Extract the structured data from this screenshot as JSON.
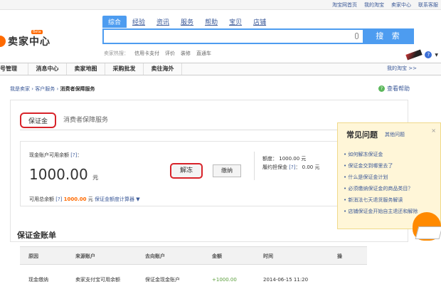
{
  "topbar": {
    "links": [
      "淘宝网首页",
      "我的淘宝",
      "卖家中心",
      "联系客服"
    ]
  },
  "logo": {
    "text": "卖家中心",
    "badge": "Beta"
  },
  "search": {
    "tabs": [
      "综合",
      "经验",
      "资讯",
      "服务",
      "帮助",
      "宝贝",
      "店铺"
    ],
    "button": "搜 索",
    "hot_label": "卖家热搜：",
    "hot_items": [
      "信用卡支付",
      "评价",
      "装修",
      "直通车"
    ]
  },
  "nav": {
    "items": [
      "号管理",
      "消息中心",
      "卖家地图",
      "采购批发",
      "卖往海外"
    ],
    "right_link": "我的淘宝 >>"
  },
  "breadcrumb": {
    "parts": [
      "我是卖家",
      "客户服务"
    ],
    "current": "消费者保障服务"
  },
  "help_link": "查看帮助",
  "tabs": [
    "保证金",
    "消费者保障服务"
  ],
  "account": {
    "label": "现金账户可用余额",
    "q": "[?]",
    "amount": "1000.00",
    "unit": "元",
    "btn_unfreeze": "解冻",
    "btn_pay": "缴纳",
    "quota_label": "额度：",
    "quota_value": "1000.00 元",
    "perf_label": "履约担保金",
    "perf_value": "0.00 元",
    "avail_label": "可用总余额",
    "avail_amount": "1000.00",
    "avail_unit": "元",
    "calc_link": "保证金额度计算器"
  },
  "ledger": {
    "title": "保证金账单",
    "headers": [
      "原因",
      "来源账户",
      "去向账户",
      "金额",
      "时间",
      "操"
    ],
    "rows": [
      [
        "现金缴纳",
        "卖家支付宝可用余额",
        "保证金现金账户",
        "+1000.00",
        "2014-06-15 11:20",
        ""
      ]
    ]
  },
  "faq": {
    "title": "常见问题",
    "other": "其他问题",
    "close": "×",
    "items": [
      "如何解冻保证金",
      "保证金交到哪里去了",
      "什么是保证金计划",
      "必须缴纳保证金的商品类目？",
      "新消法七天退货服务解读",
      "店铺保证金开始自主退还和解除"
    ]
  }
}
